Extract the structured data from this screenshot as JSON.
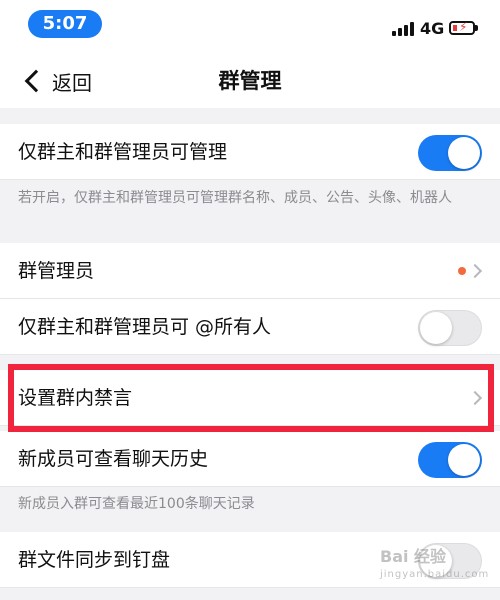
{
  "status_bar": {
    "time": "5:07",
    "network": "4G",
    "battery": {
      "level": 0.15,
      "charging": true,
      "color": "#e83a3a"
    },
    "accent": "#1a7cf5"
  },
  "nav": {
    "back_label": "返回",
    "title": "群管理"
  },
  "settings": {
    "admin_only_manage": {
      "label": "仅群主和群管理员可管理",
      "enabled": true,
      "note": "若开启，仅群主和群管理员可管理群名称、成员、公告、头像、机器人"
    },
    "group_admins": {
      "label": "群管理员",
      "has_unread_dot": true
    },
    "admin_only_at_all": {
      "label": "仅群主和群管理员可 @所有人",
      "enabled": false
    },
    "mute_setting": {
      "label": "设置群内禁言",
      "highlighted": true
    },
    "new_member_history": {
      "label": "新成员可查看聊天历史",
      "enabled": true,
      "note": "新成员入群可查看最近100条聊天记录"
    },
    "sync_files": {
      "label": "群文件同步到钉盘",
      "enabled": false
    }
  },
  "colors": {
    "toggle_on": "#1a7cf5",
    "highlight_border": "#f0243c",
    "badge_dot": "#f26a3d"
  },
  "watermark": {
    "brand": "Bai 经验",
    "url": "jingyan.baidu.com"
  }
}
